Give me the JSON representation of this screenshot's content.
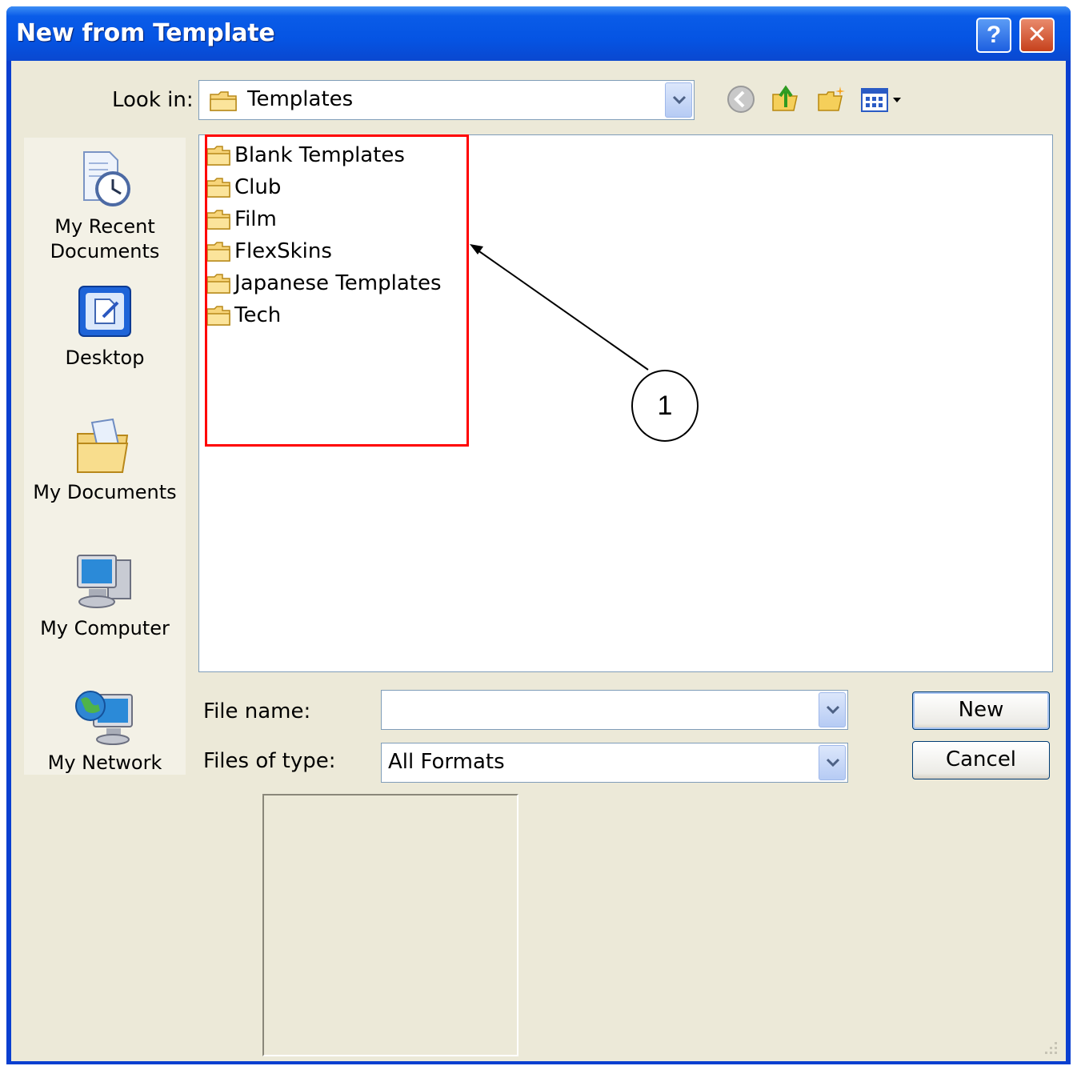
{
  "window": {
    "title": "New from Template"
  },
  "titlebar_buttons": {
    "help": "?",
    "close": "✕"
  },
  "look_in": {
    "label": "Look in:",
    "value": "Templates"
  },
  "toolbar_icons": [
    "back-icon",
    "up-folder-icon",
    "new-folder-icon",
    "view-menu-icon"
  ],
  "places": [
    {
      "label_line1": "My Recent",
      "label_line2": "Documents",
      "icon": "recent-documents-icon"
    },
    {
      "label_line1": "Desktop",
      "label_line2": "",
      "icon": "desktop-icon"
    },
    {
      "label_line1": "My Documents",
      "label_line2": "",
      "icon": "my-documents-icon"
    },
    {
      "label_line1": "My Computer",
      "label_line2": "",
      "icon": "my-computer-icon"
    },
    {
      "label_line1": "My Network",
      "label_line2": "",
      "icon": "my-network-icon"
    }
  ],
  "files": [
    {
      "name": "Blank Templates",
      "icon": "folder-icon"
    },
    {
      "name": "Club",
      "icon": "folder-icon"
    },
    {
      "name": "Film",
      "icon": "folder-icon"
    },
    {
      "name": "FlexSkins",
      "icon": "folder-icon"
    },
    {
      "name": "Japanese Templates",
      "icon": "folder-icon"
    },
    {
      "name": "Tech",
      "icon": "folder-icon"
    }
  ],
  "file_name": {
    "label": "File name:",
    "value": ""
  },
  "files_of_type": {
    "label": "Files of type:",
    "value": "All Formats"
  },
  "buttons": {
    "new": "New",
    "cancel": "Cancel"
  },
  "annotation": {
    "number": "1",
    "highlight_color": "#ff0000"
  },
  "colors": {
    "titlebar": "#0554e3",
    "dialog_bg": "#ece9d8",
    "highlight": "#ff0000"
  }
}
